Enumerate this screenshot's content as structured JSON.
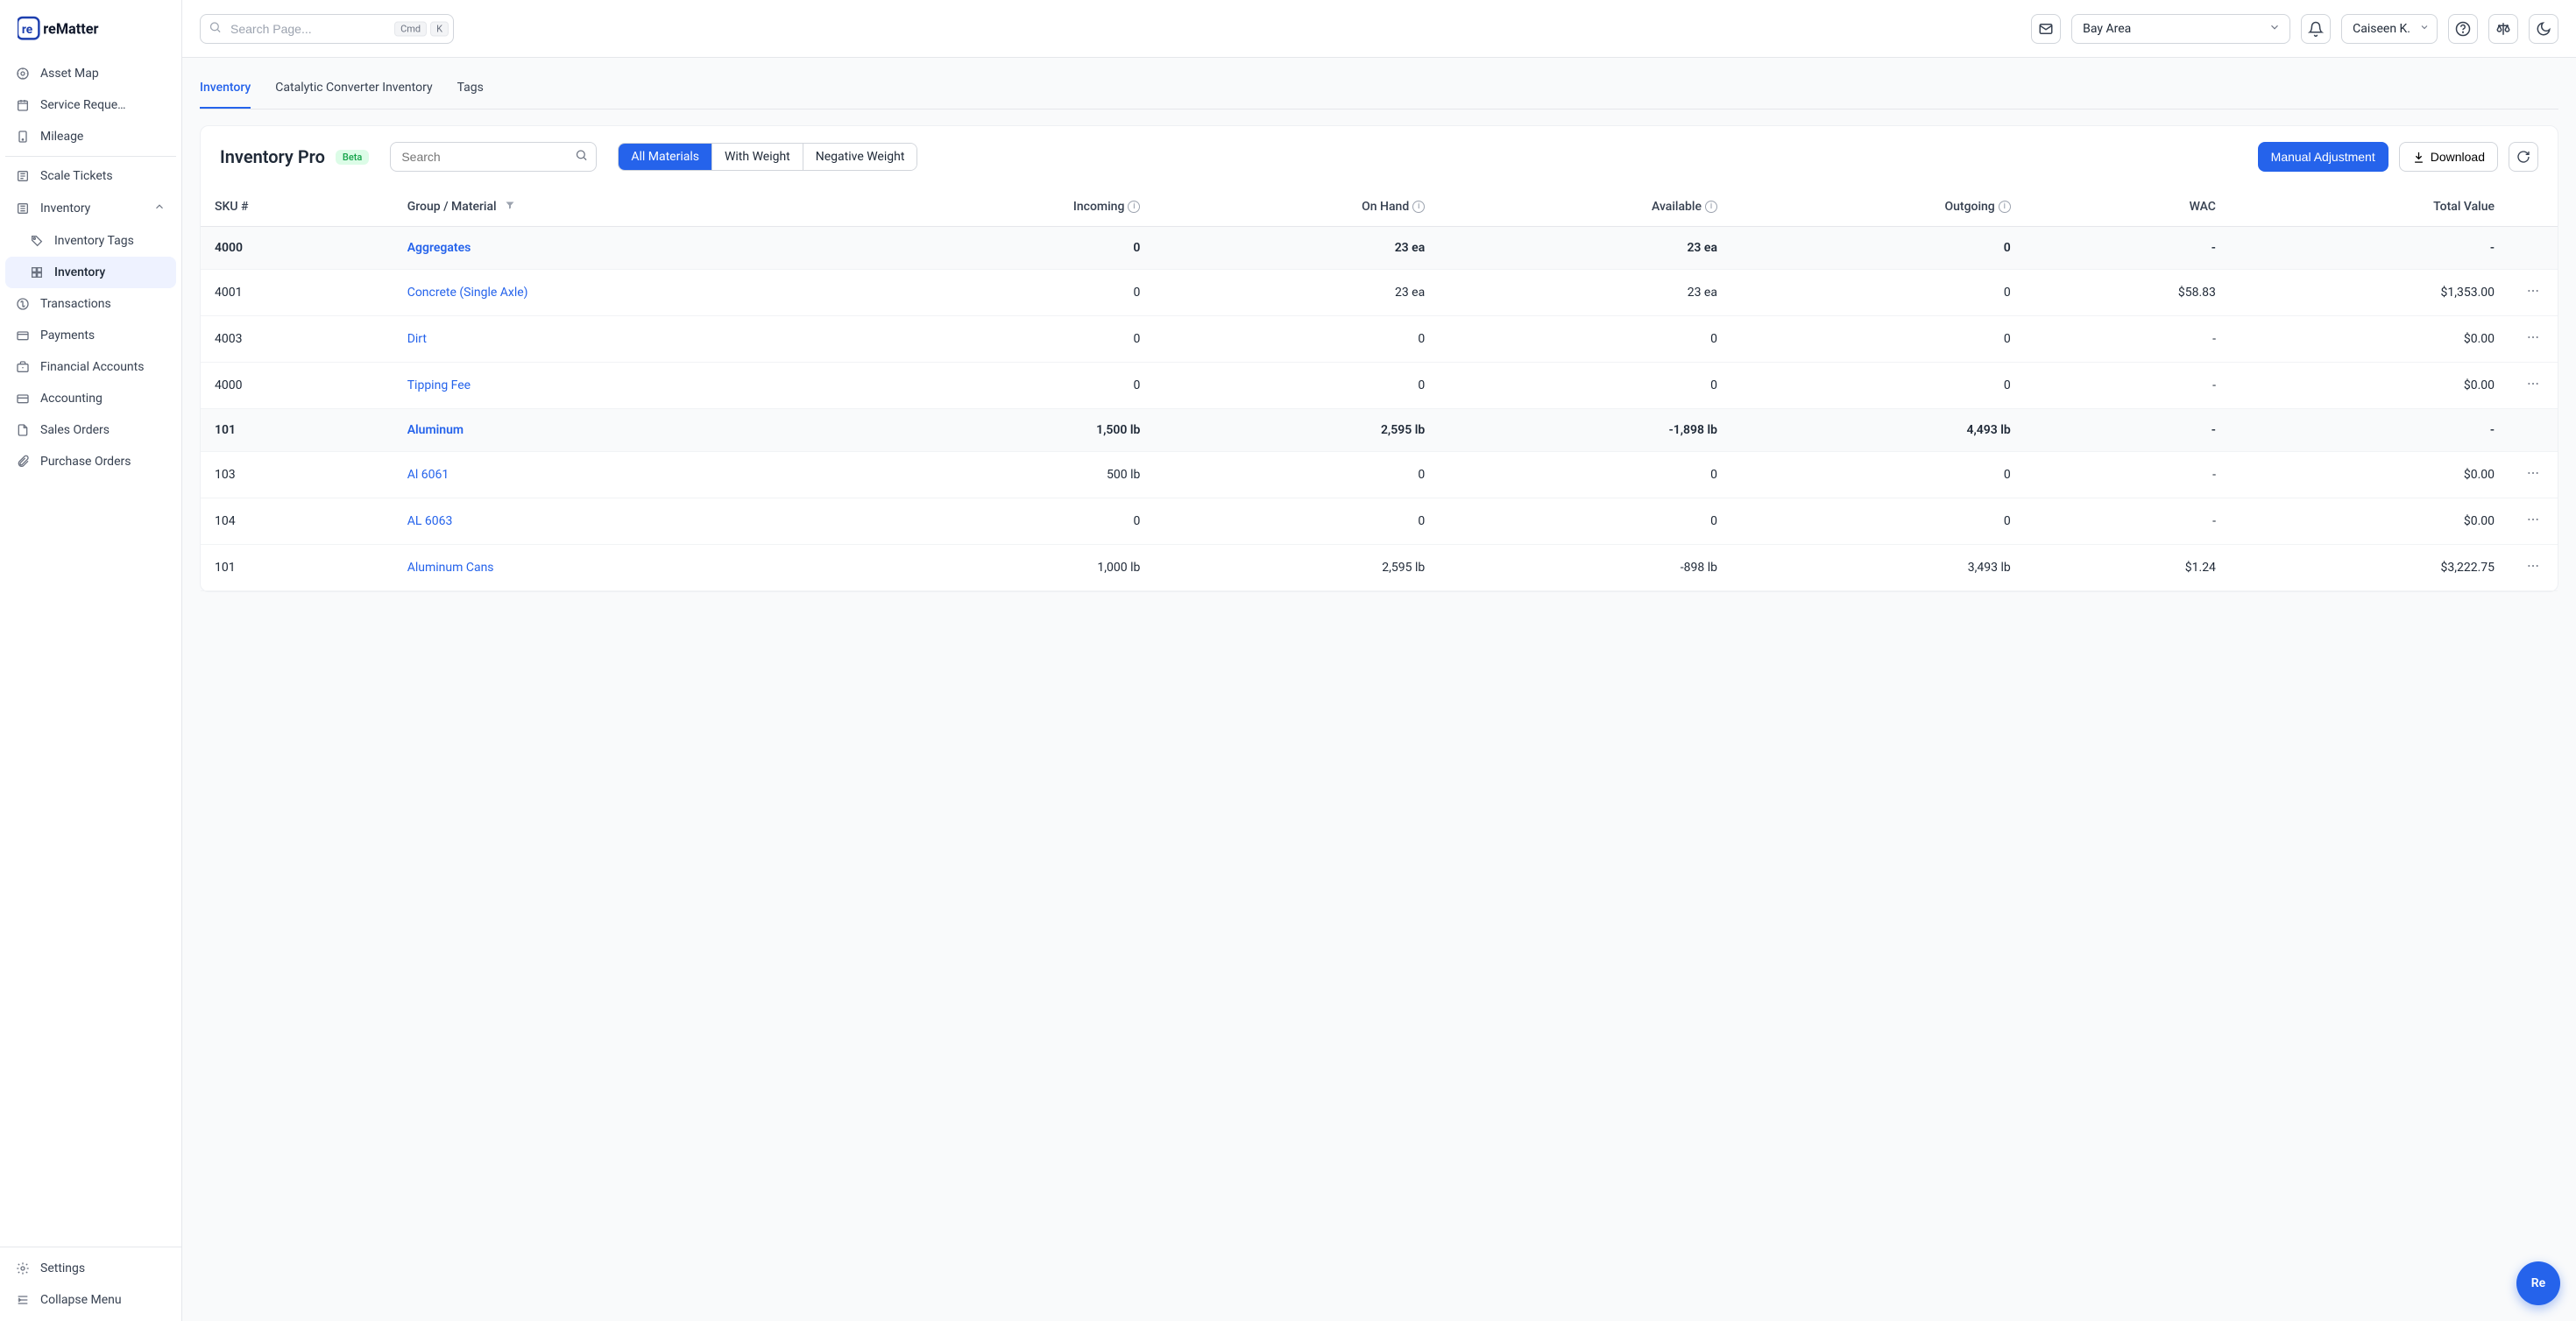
{
  "brand": {
    "name": "reMatter"
  },
  "search": {
    "placeholder": "Search Page...",
    "kbd1": "Cmd",
    "kbd2": "K"
  },
  "topbar": {
    "location": "Bay Area",
    "user": "Caiseen K."
  },
  "sidebar": {
    "items": [
      {
        "label": "Asset Map",
        "icon": "map-pin-icon"
      },
      {
        "label": "Service Reque…",
        "icon": "calendar-icon"
      },
      {
        "label": "Mileage",
        "icon": "route-icon"
      },
      {
        "label": "Scale Tickets",
        "icon": "ticket-icon",
        "dividerBefore": true
      },
      {
        "label": "Inventory",
        "icon": "box-icon",
        "expandable": true,
        "expanded": true
      },
      {
        "label": "Inventory Tags",
        "icon": "tag-icon",
        "sub": true
      },
      {
        "label": "Inventory",
        "icon": "grid-icon",
        "sub": true,
        "active": true
      },
      {
        "label": "Transactions",
        "icon": "dollar-icon"
      },
      {
        "label": "Payments",
        "icon": "wallet-icon"
      },
      {
        "label": "Financial Accounts",
        "icon": "briefcase-icon"
      },
      {
        "label": "Accounting",
        "icon": "card-icon"
      },
      {
        "label": "Sales Orders",
        "icon": "file-icon"
      },
      {
        "label": "Purchase Orders",
        "icon": "clip-icon"
      }
    ],
    "footer": [
      {
        "label": "Settings",
        "icon": "gear-icon"
      },
      {
        "label": "Collapse Menu",
        "icon": "collapse-icon"
      }
    ]
  },
  "subtabs": [
    {
      "label": "Inventory",
      "active": true
    },
    {
      "label": "Catalytic Converter Inventory"
    },
    {
      "label": "Tags"
    }
  ],
  "panel": {
    "title": "Inventory Pro",
    "badge": "Beta",
    "searchPlaceholder": "Search",
    "filters": [
      {
        "label": "All Materials",
        "active": true
      },
      {
        "label": "With Weight"
      },
      {
        "label": "Negative Weight"
      }
    ],
    "manualAdjust": "Manual Adjustment",
    "download": "Download"
  },
  "table": {
    "columns": [
      "SKU #",
      "Group / Material",
      "Incoming",
      "On Hand",
      "Available",
      "Outgoing",
      "WAC",
      "Total Value"
    ],
    "rows": [
      {
        "type": "group",
        "sku": "4000",
        "material": "Aggregates",
        "incoming": "0",
        "onhand": "23 ea",
        "available": "23 ea",
        "outgoing": "0",
        "wac": "-",
        "total": "-"
      },
      {
        "type": "item",
        "sku": "4001",
        "material": "Concrete (Single Axle)",
        "incoming": "0",
        "onhand": "23 ea",
        "available": "23 ea",
        "outgoing": "0",
        "wac": "$58.83",
        "total": "$1,353.00"
      },
      {
        "type": "item",
        "sku": "4003",
        "material": "Dirt",
        "incoming": "0",
        "onhand": "0",
        "available": "0",
        "outgoing": "0",
        "wac": "-",
        "total": "$0.00"
      },
      {
        "type": "item",
        "sku": "4000",
        "material": "Tipping Fee",
        "incoming": "0",
        "onhand": "0",
        "available": "0",
        "outgoing": "0",
        "wac": "-",
        "total": "$0.00"
      },
      {
        "type": "group",
        "sku": "101",
        "material": "Aluminum",
        "incoming": "1,500 lb",
        "onhand": "2,595 lb",
        "available": "-1,898 lb",
        "outgoing": "4,493 lb",
        "wac": "-",
        "total": "-"
      },
      {
        "type": "item",
        "sku": "103",
        "material": "Al 6061",
        "incoming": "500 lb",
        "onhand": "0",
        "available": "0",
        "outgoing": "0",
        "wac": "-",
        "total": "$0.00"
      },
      {
        "type": "item",
        "sku": "104",
        "material": "AL 6063",
        "incoming": "0",
        "onhand": "0",
        "available": "0",
        "outgoing": "0",
        "wac": "-",
        "total": "$0.00"
      },
      {
        "type": "item",
        "sku": "101",
        "material": "Aluminum Cans",
        "incoming": "1,000 lb",
        "onhand": "2,595 lb",
        "available": "-898 lb",
        "outgoing": "3,493 lb",
        "wac": "$1.24",
        "total": "$3,222.75"
      }
    ]
  },
  "fab": "Re"
}
